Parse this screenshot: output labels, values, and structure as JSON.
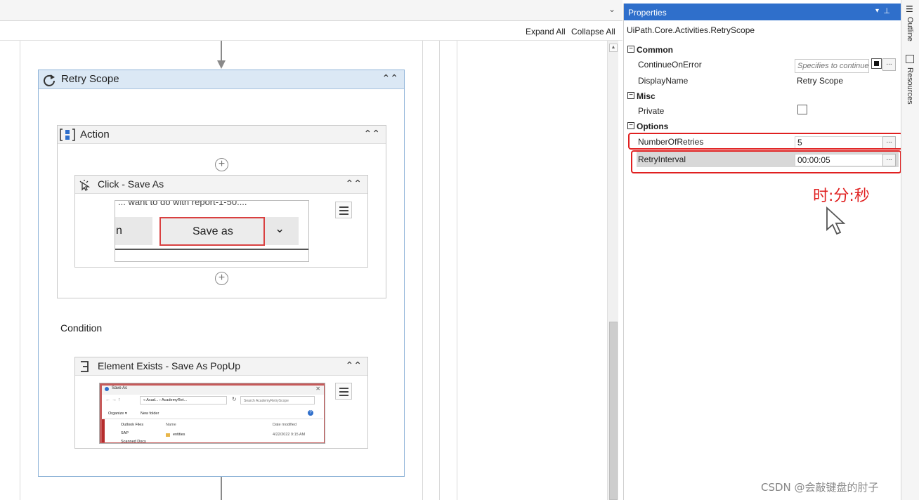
{
  "toolbar": {
    "expand_all": "Expand All",
    "collapse_all": "Collapse All"
  },
  "retry_scope": {
    "title": "Retry Scope"
  },
  "action": {
    "title": "Action"
  },
  "click_activity": {
    "title": "Click - Save As",
    "thumb_text": "... want to do with report-1-50....",
    "save_as_label": "Save as",
    "left_btn_fragment": "n"
  },
  "condition": {
    "label": "Condition"
  },
  "element_exists": {
    "title": "Element Exists - Save As PopUp",
    "thumb": {
      "window_title": "Save As",
      "path": "« Acad... › AcademyRet...",
      "search": "Search AcademyRetryScope",
      "organize": "Organize ▾",
      "new_folder": "New folder",
      "col_name": "Name",
      "col_date": "Date modified",
      "side_items": [
        "Outlook Files",
        "SAP",
        "Scanned Docs"
      ],
      "rows": [
        {
          "name": "entities",
          "date": "4/22/2022 9:15 AM"
        }
      ]
    }
  },
  "properties": {
    "panel_title": "Properties",
    "activity_type": "UiPath.Core.Activities.RetryScope",
    "categories": {
      "common": "Common",
      "misc": "Misc",
      "options": "Options"
    },
    "continue_on_error": {
      "name": "ContinueOnError",
      "placeholder": "Specifies to continue"
    },
    "display_name": {
      "name": "DisplayName",
      "value": "Retry Scope"
    },
    "private": {
      "name": "Private"
    },
    "number_of_retries": {
      "name": "NumberOfRetries",
      "value": "5"
    },
    "retry_interval": {
      "name": "RetryInterval",
      "value": "00:00:05"
    },
    "dots": "..."
  },
  "side_tabs": {
    "outline": "Outline",
    "resources": "Resources"
  },
  "annotation": {
    "text": "时:分:秒",
    "color": "#e02020"
  },
  "watermark": "CSDN @会敲键盘的肘子"
}
